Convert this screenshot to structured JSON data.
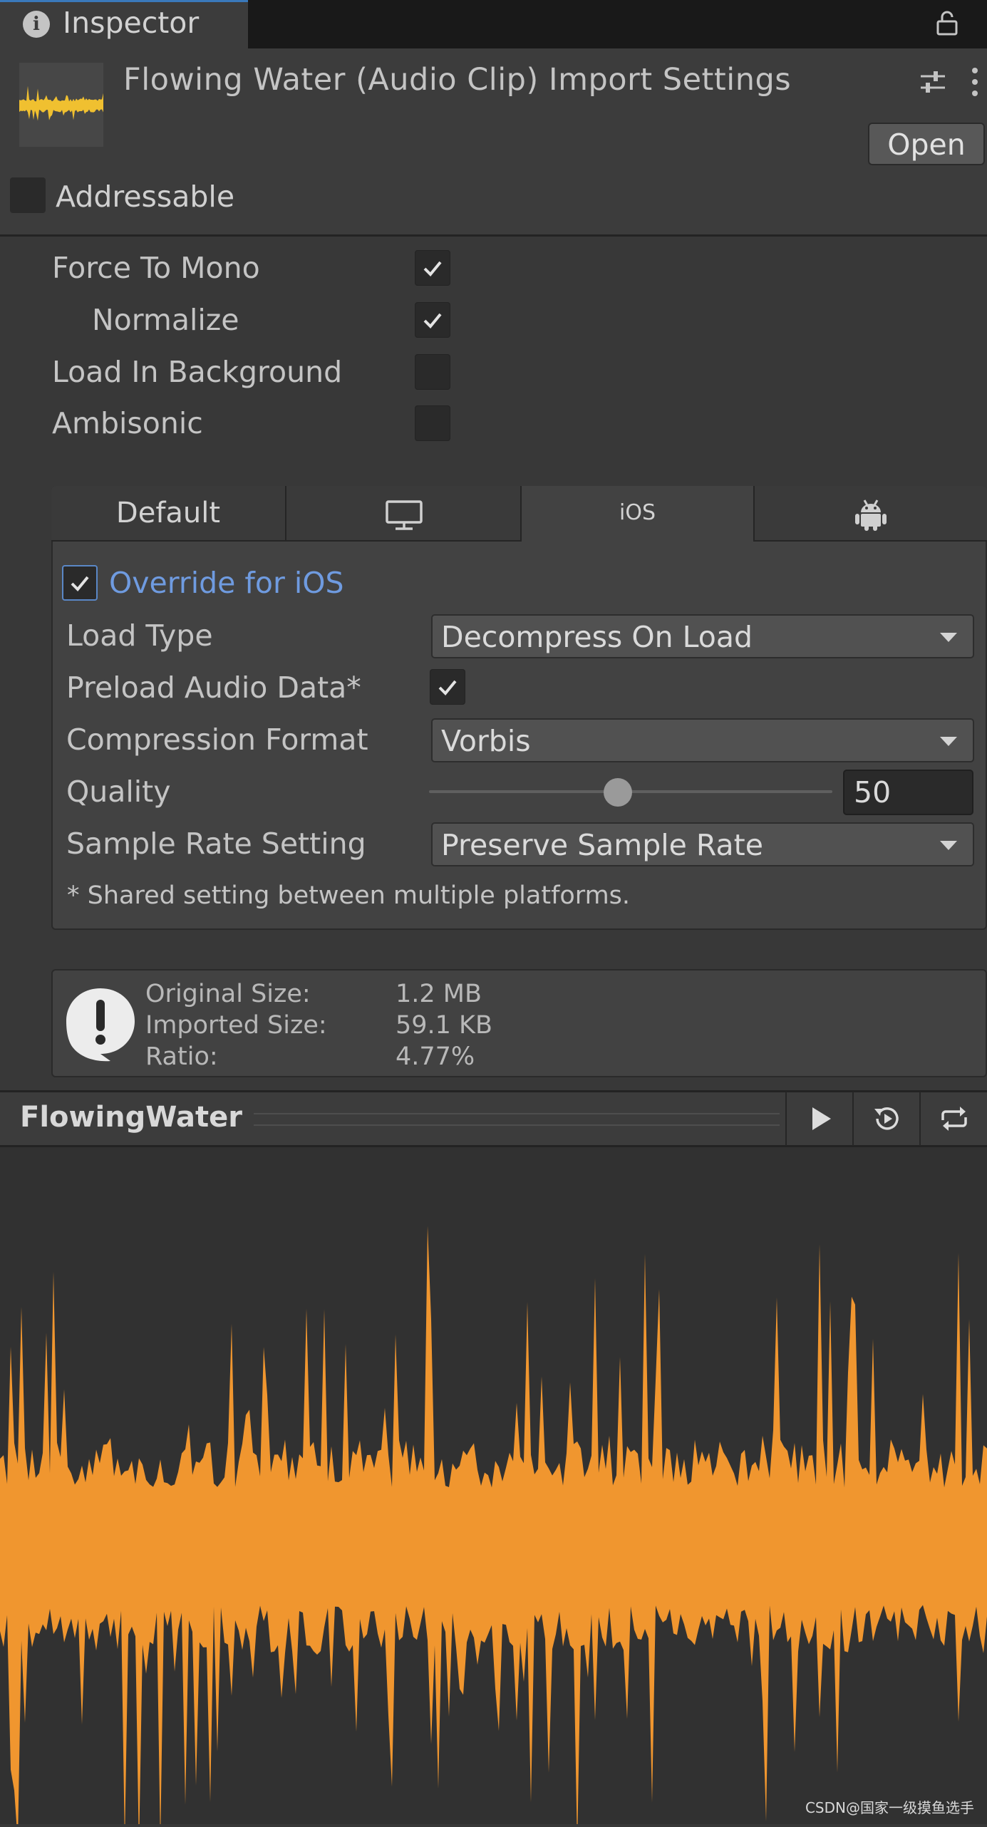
{
  "tabbar": {
    "title": "Inspector"
  },
  "header": {
    "title": "Flowing Water (Audio Clip) Import Settings",
    "open_label": "Open",
    "addressable_label": "Addressable",
    "addressable_checked": false
  },
  "properties": {
    "force_to_mono": {
      "label": "Force To Mono",
      "checked": true
    },
    "normalize": {
      "label": "Normalize",
      "checked": true
    },
    "load_in_background": {
      "label": "Load In Background",
      "checked": false
    },
    "ambisonic": {
      "label": "Ambisonic",
      "checked": false
    }
  },
  "platform_tabs": [
    {
      "label": "Default",
      "icon": ""
    },
    {
      "label": "",
      "icon": "monitor-icon"
    },
    {
      "label": "iOS",
      "icon": "",
      "active": true
    },
    {
      "label": "",
      "icon": "android-icon"
    }
  ],
  "platform_settings": {
    "override_label": "Override for iOS",
    "override_checked": true,
    "load_type": {
      "label": "Load Type",
      "value": "Decompress On Load"
    },
    "preload_audio_data": {
      "label": "Preload Audio Data*",
      "checked": true
    },
    "compression_format": {
      "label": "Compression Format",
      "value": "Vorbis"
    },
    "quality": {
      "label": "Quality",
      "value": "50",
      "slider_fraction": 0.5
    },
    "sample_rate_setting": {
      "label": "Sample Rate Setting",
      "value": "Preserve Sample Rate"
    },
    "footnote": "* Shared setting between multiple platforms."
  },
  "info": {
    "original_size_label": "Original Size:",
    "original_size_value": "1.2 MB",
    "imported_size_label": "Imported Size:",
    "imported_size_value": "59.1 KB",
    "ratio_label": "Ratio:",
    "ratio_value": "4.77%"
  },
  "preview": {
    "title": "FlowingWater",
    "buttons": [
      "play-icon",
      "autoplay-icon",
      "loop-icon"
    ]
  },
  "colors": {
    "waveform": "#f0962f",
    "thumbnail_waveform": "#f0c030",
    "accent": "#6f9be0"
  },
  "watermark": "CSDN@国家一级摸鱼选手"
}
